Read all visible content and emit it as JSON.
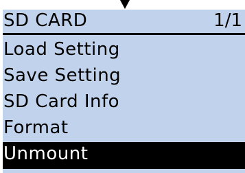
{
  "header": {
    "title": "SD CARD",
    "page": "1/1"
  },
  "menu": {
    "items": [
      {
        "label": "Load Setting"
      },
      {
        "label": "Save Setting"
      },
      {
        "label": "SD Card Info"
      },
      {
        "label": "Format"
      },
      {
        "label": "Unmount"
      }
    ],
    "selected": "Unmount"
  },
  "icons": {
    "pointer": "down-arrow-icon"
  },
  "colors": {
    "background": "#c1d3ec",
    "selected_background": "#000000",
    "selected_text": "#ffffff",
    "text": "#000000"
  }
}
